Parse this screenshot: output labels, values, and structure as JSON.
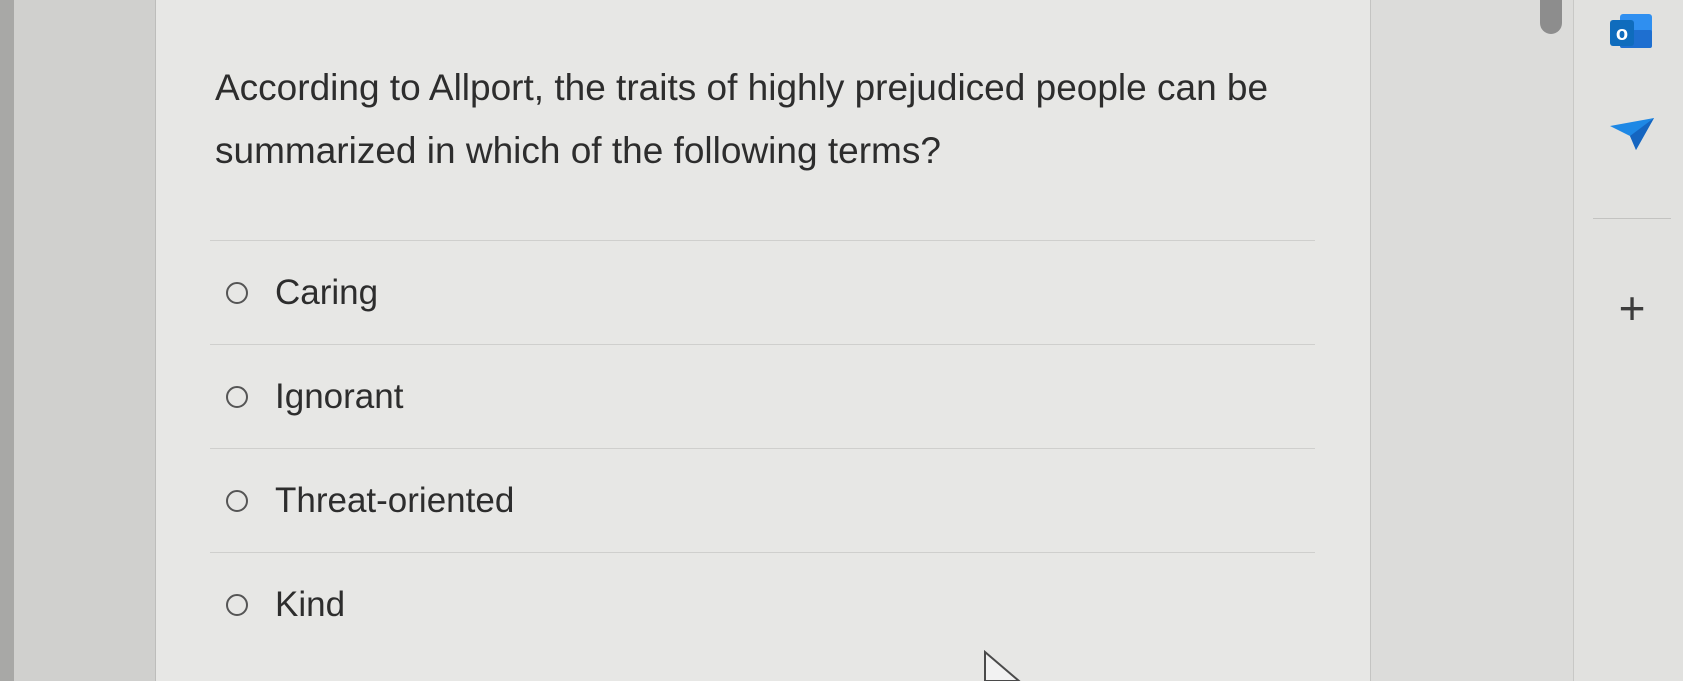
{
  "question": {
    "text": "According to Allport, the traits of highly prejudiced people can be summarized in which of the following terms?"
  },
  "options": [
    {
      "label": "Caring",
      "selected": false
    },
    {
      "label": "Ignorant",
      "selected": false
    },
    {
      "label": "Threat-oriented",
      "selected": false
    },
    {
      "label": "Kind",
      "selected": false
    }
  ],
  "side_rail": {
    "icons": [
      "outlook-icon",
      "send-icon",
      "add-icon"
    ],
    "add_glyph": "+",
    "outlook_glyph": "o"
  },
  "colors": {
    "outlook_blue": "#0f6cbd",
    "send_blue": "#1e88e5",
    "text": "#2d2d2d"
  }
}
